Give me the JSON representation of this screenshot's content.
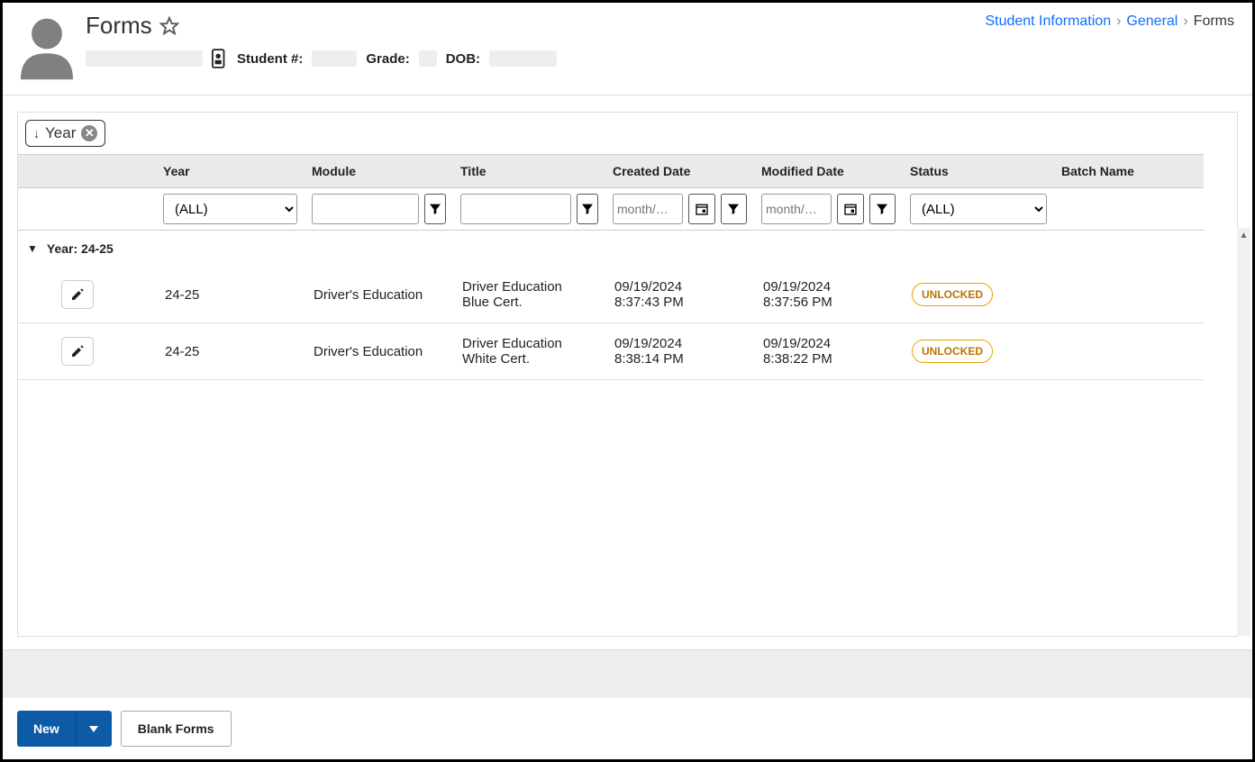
{
  "page": {
    "title": "Forms"
  },
  "breadcrumbs": {
    "a": "Student Information",
    "b": "General",
    "c": "Forms"
  },
  "student_labels": {
    "number": "Student #:",
    "grade": "Grade:",
    "dob": "DOB:"
  },
  "sort_chip": {
    "label": "Year"
  },
  "columns": {
    "year": "Year",
    "module": "Module",
    "title": "Title",
    "created": "Created Date",
    "modified": "Modified Date",
    "status": "Status",
    "batch": "Batch Name"
  },
  "filters": {
    "year_selected": "(ALL)",
    "status_selected": "(ALL)",
    "date_placeholder": "month/…"
  },
  "group": {
    "heading": "Year: 24-25"
  },
  "rows": [
    {
      "year": "24-25",
      "module": "Driver's Education",
      "title_l1": "Driver Education",
      "title_l2": "Blue Cert.",
      "created_l1": "09/19/2024",
      "created_l2": "8:37:43 PM",
      "modified_l1": "09/19/2024",
      "modified_l2": "8:37:56 PM",
      "status": "UNLOCKED",
      "batch": ""
    },
    {
      "year": "24-25",
      "module": "Driver's Education",
      "title_l1": "Driver Education",
      "title_l2": "White Cert.",
      "created_l1": "09/19/2024",
      "created_l2": "8:38:14 PM",
      "modified_l1": "09/19/2024",
      "modified_l2": "8:38:22 PM",
      "status": "UNLOCKED",
      "batch": ""
    }
  ],
  "buttons": {
    "new": "New",
    "blank": "Blank Forms"
  }
}
